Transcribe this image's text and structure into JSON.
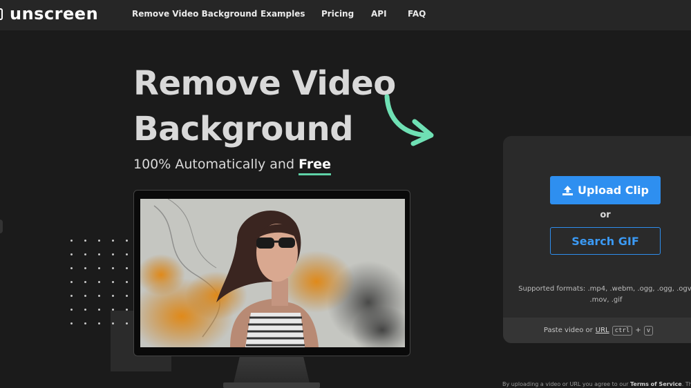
{
  "nav": {
    "logo": "unscreen",
    "links": [
      "Remove Video Background",
      "Examples",
      "Pricing",
      "API",
      "FAQ"
    ]
  },
  "hero": {
    "title_line1": "Remove Video",
    "title_line2": "Background",
    "subtitle_prefix": "100% Automatically and",
    "subtitle_emphasis": "Free"
  },
  "panel": {
    "upload_label": "Upload Clip",
    "or_label": "or",
    "search_label": "Search GIF",
    "formats_text": "Supported formats: .mp4, .webm, .ogg, .ogg, .ogv, .mov, .gif",
    "paste_prefix": "Paste video or",
    "paste_url": "URL",
    "kbd_ctrl": "ctrl",
    "kbd_plus": "+",
    "kbd_v": "v"
  },
  "legal": {
    "prefix": "By uploading a video or URL you agree to our",
    "tos": "Terms of Service",
    "suffix": ". This site"
  },
  "colors": {
    "accent_blue": "#2e8ff0",
    "accent_mint": "#5fd3a8",
    "background": "#1b1b1b",
    "nav_bg": "#262626"
  },
  "icons": [
    "upload-icon",
    "curved-arrow-icon"
  ]
}
